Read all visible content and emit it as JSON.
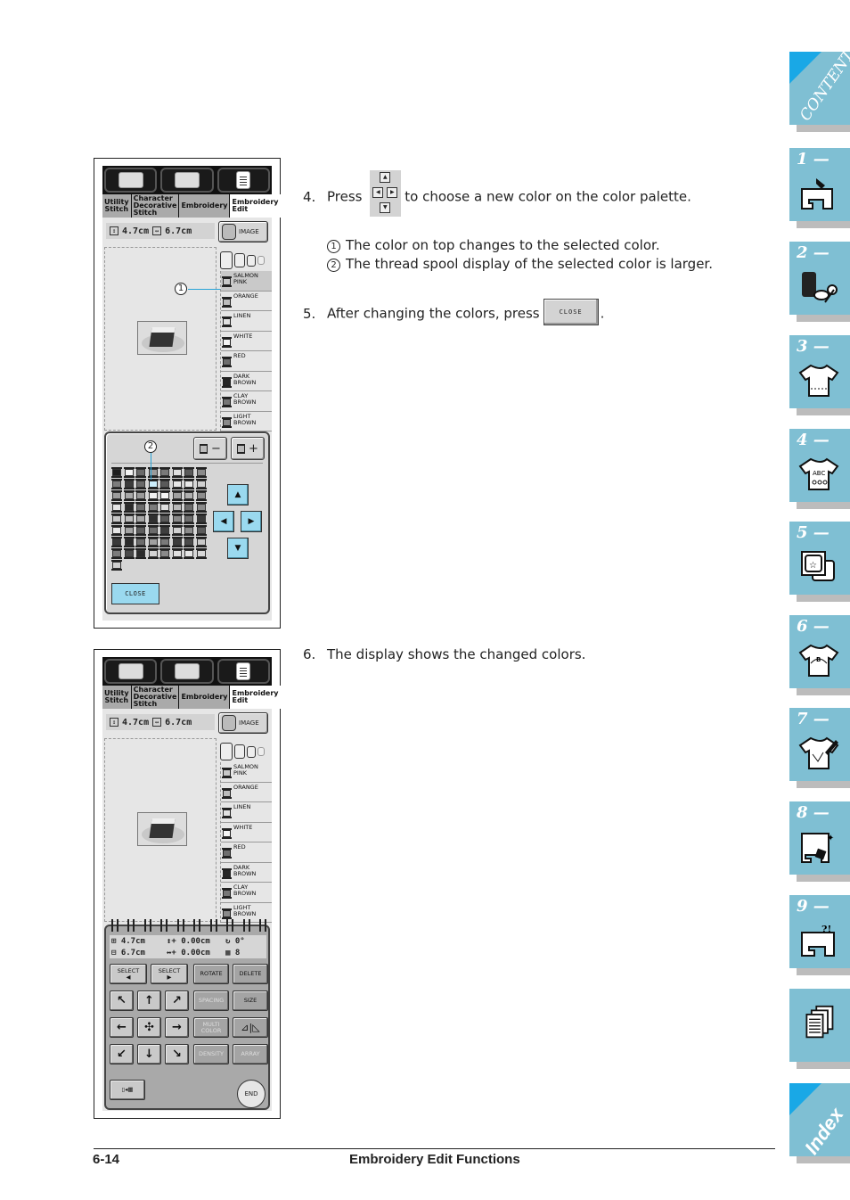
{
  "screen_ui": {
    "tabs": [
      {
        "label": "Utility\nStitch"
      },
      {
        "label": "Character\nDecorative\nStitch"
      },
      {
        "label": "Embroidery"
      },
      {
        "label": "Embroidery\nEdit"
      }
    ],
    "size_height": "4.7cm",
    "size_width": "6.7cm",
    "image_button": "IMAGE",
    "colors": [
      {
        "name": "SALMON\nPINK",
        "fill": "#c8c8c8"
      },
      {
        "name": "ORANGE",
        "fill": "#bdbdbd"
      },
      {
        "name": "LINEN",
        "fill": "#e0e0e0"
      },
      {
        "name": "WHITE",
        "fill": "#f4f4f4"
      },
      {
        "name": "RED",
        "fill": "#6e6e6e"
      },
      {
        "name": "DARK\nBROWN",
        "fill": "#262626"
      },
      {
        "name": "CLAY\nBROWN",
        "fill": "#777777"
      },
      {
        "name": "LIGHT\nBROWN",
        "fill": "#8a8a8a"
      }
    ]
  },
  "screen1": {
    "callout1": "1",
    "callout2": "2",
    "palette_selected_index": 11,
    "palette": [
      "#1e1e1e",
      "#f4f4f4",
      "#6a6a6a",
      "#9a9a9a",
      "#7a7a7a",
      "#e0e0e0",
      "#5a5a5a",
      "#8a8a8a",
      "#7c7c7c",
      "#3c3c3c",
      "#6a6a6a",
      "#cdeefc",
      "#5a5a5a",
      "#e8e8e8",
      "#e8e8e8",
      "#d0d0d0",
      "#9c9c9c",
      "#a8a8a8",
      "#9a9a9a",
      "#f0f0f0",
      "#f6f6f6",
      "#a0a0a0",
      "#b0b0b0",
      "#8c8c8c",
      "#e4e4e4",
      "#2a2a2a",
      "#6c6c6c",
      "#7c7c7c",
      "#e0e0e0",
      "#b8b8b8",
      "#6a6a6a",
      "#8a8a8a",
      "#c8c8c8",
      "#bcbcbc",
      "#a6a6a6",
      "#2e2e2e",
      "#5a5a5a",
      "#8a8a8a",
      "#6e6e6e",
      "#3a3a3a",
      "#e6e6e6",
      "#a4a4a4",
      "#5e5e5e",
      "#6c6c6c",
      "#3e3e3e",
      "#d0d0d0",
      "#8c8c8c",
      "#5c5c5c",
      "#3a3a3a",
      "#2a2a2a",
      "#6c6c6c",
      "#a0a0a0",
      "#7a7a7a",
      "#3c3c3c",
      "#4a4a4a",
      "#c8c8c8",
      "#7c7c7c",
      "#4a4a4a",
      "#2c2c2c",
      "#d4d4d4",
      "#8a8a8a",
      "#e0e0e0",
      "#e6e6e6",
      "#d8d8d8",
      "#d0d0d0"
    ],
    "spool_minus": "−",
    "spool_plus": "+",
    "up_arrow": "▲",
    "left_arrow": "◀",
    "right_arrow": "▶",
    "down_arrow": "▼",
    "close_button": "CLOSE"
  },
  "screen2": {
    "info": {
      "height": "4.7cm",
      "width": "6.7cm",
      "offset_v": "0.00cm",
      "offset_h": "0.00cm",
      "rotation": "0°",
      "colors_count": "8"
    },
    "buttons": {
      "select_prev": "SELECT\n◀",
      "select_next": "SELECT\n▶",
      "rotate": "ROTATE",
      "delete": "DELETE",
      "spacing": "SPACING",
      "size": "SIZE",
      "multi_color": "MULTI\nCOLOR",
      "density": "DENSITY",
      "array": "ARRAY",
      "end": "END",
      "arrow_ul": "↖",
      "arrow_up": "↑",
      "arrow_ur": "↗",
      "arrow_left": "←",
      "center": "✣",
      "arrow_right": "→",
      "arrow_dl": "↙",
      "arrow_down": "↓",
      "arrow_dr": "↘",
      "mirror": "⊿|◺"
    }
  },
  "instructions": {
    "step4_num": "4.",
    "step4_before": "Press",
    "step4_after": "to choose a new color on the color palette.",
    "note1_num": "1",
    "note1": "The color on top changes to the selected color.",
    "note2_num": "2",
    "note2": "The thread spool display of the selected color is larger.",
    "step5_num": "5.",
    "step5_before": "After changing the colors, press",
    "step5_button": "CLOSE",
    "step5_after": ".",
    "step6_num": "6.",
    "step6": "The display shows the changed colors.",
    "arrow_up": "▲",
    "arrow_left": "◀",
    "arrow_right": "▶",
    "arrow_down": "▼"
  },
  "footer": {
    "page_number": "6-14",
    "section_title": "Embroidery Edit Functions"
  },
  "side_nav": {
    "contents": "CONTENTS",
    "chapters": [
      "1 —",
      "2 —",
      "3 —",
      "4 —",
      "5 —",
      "6 —",
      "7 —",
      "8 —",
      "9 —"
    ],
    "index": "Index"
  }
}
